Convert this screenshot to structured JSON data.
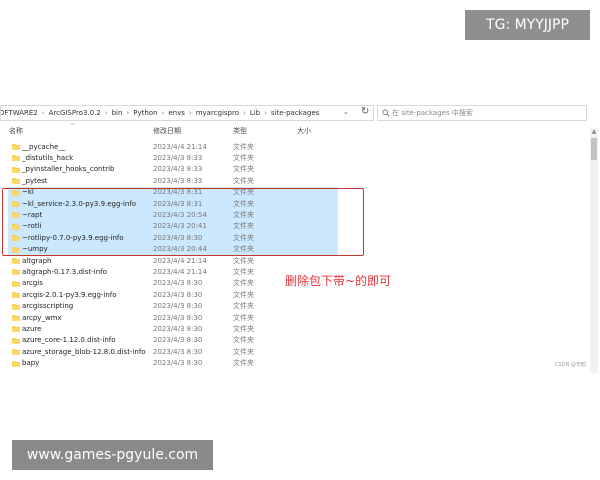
{
  "watermark_top": "TG: MYYJJPP",
  "watermark_bottom": "www.games-pgyule.com",
  "address": {
    "crumbs": [
      "OFTWARE2",
      "ArcGISPro3.0.2",
      "bin",
      "Python",
      "envs",
      "myarcgispro",
      "Lib",
      "site-packages"
    ]
  },
  "search": {
    "placeholder": "在 site-packages 中搜索"
  },
  "columns": {
    "name": "名称",
    "date": "修改日期",
    "type": "类型",
    "size": "大小"
  },
  "rows": [
    {
      "name": "__pycache__",
      "date": "2023/4/4 21:14",
      "type": "文件夹",
      "selected": false
    },
    {
      "name": "_distutils_hack",
      "date": "2023/4/3 8:33",
      "type": "文件夹",
      "selected": false
    },
    {
      "name": "_pyinstaller_hooks_contrib",
      "date": "2023/4/3 8:33",
      "type": "文件夹",
      "selected": false
    },
    {
      "name": "_pytest",
      "date": "2023/4/3 8:33",
      "type": "文件夹",
      "selected": false
    },
    {
      "name": "~kl",
      "date": "2023/4/3 8:31",
      "type": "文件夹",
      "selected": true
    },
    {
      "name": "~kl_service-2.3.0-py3.9.egg-info",
      "date": "2023/4/3 8:31",
      "type": "文件夹",
      "selected": true
    },
    {
      "name": "~rapt",
      "date": "2023/4/3 20:54",
      "type": "文件夹",
      "selected": true
    },
    {
      "name": "~rotli",
      "date": "2023/4/3 20:41",
      "type": "文件夹",
      "selected": true
    },
    {
      "name": "~rotlipy-0.7.0-py3.9.egg-info",
      "date": "2023/4/3 8:30",
      "type": "文件夹",
      "selected": true
    },
    {
      "name": "~umpy",
      "date": "2023/4/3 20:44",
      "type": "文件夹",
      "selected": true
    },
    {
      "name": "altgraph",
      "date": "2023/4/4 21:14",
      "type": "文件夹",
      "selected": false
    },
    {
      "name": "altgraph-0.17.3.dist-info",
      "date": "2023/4/4 21:14",
      "type": "文件夹",
      "selected": false
    },
    {
      "name": "arcgis",
      "date": "2023/4/3 8:30",
      "type": "文件夹",
      "selected": false
    },
    {
      "name": "arcgis-2.0.1-py3.9.egg-info",
      "date": "2023/4/3 8:30",
      "type": "文件夹",
      "selected": false
    },
    {
      "name": "arcgisscripting",
      "date": "2023/4/3 8:30",
      "type": "文件夹",
      "selected": false
    },
    {
      "name": "arcpy_wmx",
      "date": "2023/4/3 8:30",
      "type": "文件夹",
      "selected": false
    },
    {
      "name": "azure",
      "date": "2023/4/3 8:30",
      "type": "文件夹",
      "selected": false
    },
    {
      "name": "azure_core-1.12.0.dist-info",
      "date": "2023/4/3 8:30",
      "type": "文件夹",
      "selected": false
    },
    {
      "name": "azure_storage_blob-12.8.0.dist-info",
      "date": "2023/4/3 8:30",
      "type": "文件夹",
      "selected": false
    },
    {
      "name": "bapy",
      "date": "2023/4/3 8:30",
      "type": "文件夹",
      "selected": false
    }
  ],
  "annotation": "删除包下带~的即可",
  "csdn_mark": "CSDN @辛鸥",
  "colors": {
    "selection": "#cce8ff",
    "folder": "#f5c842",
    "highlight_border": "#c0392b",
    "annotation": "#e0323c"
  }
}
